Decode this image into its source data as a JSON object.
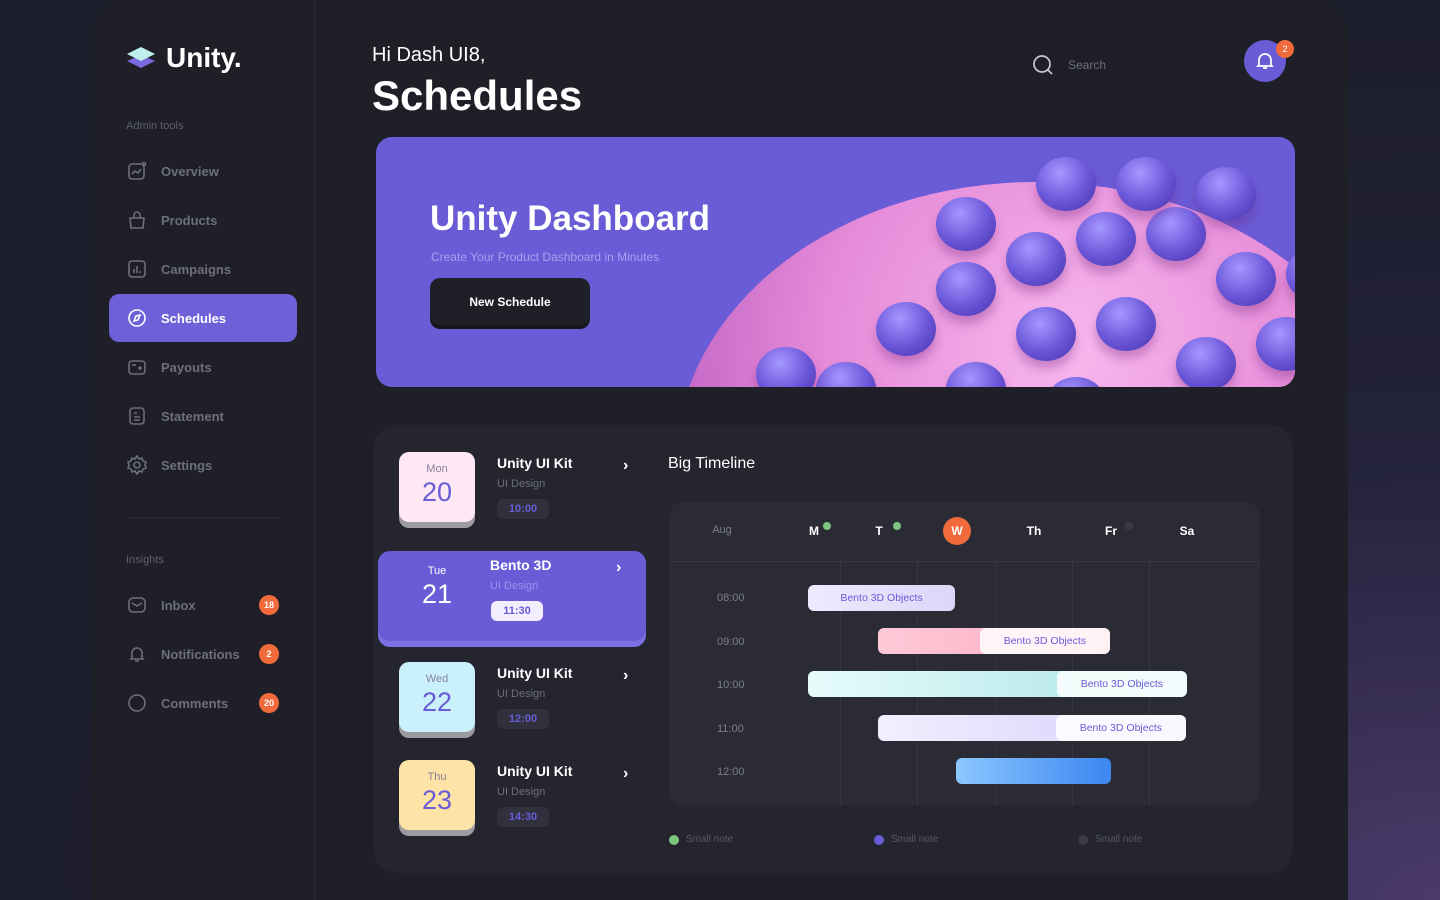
{
  "brand": {
    "name": "Unity."
  },
  "sidebar": {
    "admin_label": "Admin tools",
    "items": [
      {
        "label": "Overview",
        "icon": "chart-icon"
      },
      {
        "label": "Products",
        "icon": "bag-icon"
      },
      {
        "label": "Campaigns",
        "icon": "bar-chart-icon"
      },
      {
        "label": "Schedules",
        "icon": "compass-icon",
        "active": true
      },
      {
        "label": "Payouts",
        "icon": "wallet-icon"
      },
      {
        "label": "Statement",
        "icon": "document-icon"
      },
      {
        "label": "Settings",
        "icon": "gear-icon"
      }
    ],
    "insights_label": "Insights",
    "insights": [
      {
        "label": "Inbox",
        "badge": "18",
        "icon": "mail-icon"
      },
      {
        "label": "Notifications",
        "badge": "2",
        "icon": "bell-icon"
      },
      {
        "label": "Comments",
        "badge": "20",
        "icon": "chat-icon"
      }
    ]
  },
  "header": {
    "greeting": "Hi Dash UI8,",
    "title": "Schedules",
    "search_placeholder": "Search",
    "notification_count": "2"
  },
  "hero": {
    "title": "Unity Dashboard",
    "subtitle": "Create Your Product Dashboard in Minutes",
    "button": "New Schedule",
    "color": "#6a5bd6"
  },
  "schedule": [
    {
      "day": "Mon",
      "date": "20",
      "title": "Unity UI Kit",
      "sub": "UI Design",
      "time": "10:00",
      "color": "#fde8f3"
    },
    {
      "day": "Tue",
      "date": "21",
      "title": "Bento 3D",
      "sub": "UI Design",
      "time": "11:30",
      "active": true
    },
    {
      "day": "Wed",
      "date": "22",
      "title": "Unity UI Kit",
      "sub": "UI Design",
      "time": "12:00",
      "color": "#c9f0fb"
    },
    {
      "day": "Thu",
      "date": "23",
      "title": "Unity UI Kit",
      "sub": "UI Design",
      "time": "14:30",
      "color": "#fde3a6"
    }
  ],
  "timeline": {
    "title": "Big Timeline",
    "month": "Aug",
    "days": [
      "M",
      "T",
      "W",
      "Th",
      "Fr",
      "Sa"
    ],
    "today": "W",
    "times": [
      "08:00",
      "09:00",
      "10:00",
      "11:00",
      "12:00"
    ],
    "events": [
      {
        "label": "Bento 3D Objects"
      },
      {
        "label": "Bento 3D Objects"
      },
      {
        "label": "Bento 3D Objects"
      },
      {
        "label": "Bento 3D Objects"
      },
      {
        "label": ""
      }
    ],
    "legend": [
      {
        "label": "Small note",
        "color": "#7cc47f"
      },
      {
        "label": "Small note",
        "color": "#6a5bd6"
      },
      {
        "label": "Small note",
        "color": "#3a3b46"
      }
    ]
  }
}
